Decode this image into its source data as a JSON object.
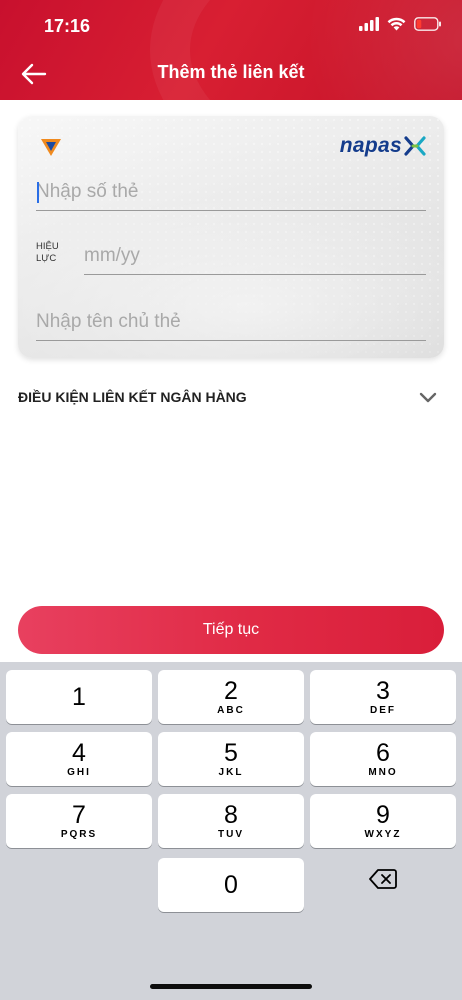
{
  "status_bar": {
    "time": "17:16"
  },
  "header": {
    "title": "Thêm thẻ liên kết"
  },
  "card": {
    "network": "napas",
    "card_number": {
      "value": "",
      "placeholder": "Nhập số thẻ"
    },
    "validity_label": "HIỆU\nLỰC",
    "expiry": {
      "value": "",
      "placeholder": "mm/yy"
    },
    "holder_name": {
      "value": "",
      "placeholder": "Nhập tên chủ thẻ"
    }
  },
  "conditions": {
    "label": "ĐIỀU KIỆN LIÊN KẾT NGÂN HÀNG",
    "icon": "chevron-down-icon"
  },
  "continue_button": {
    "label": "Tiếp tục"
  },
  "keypad": {
    "keys": [
      {
        "digit": "1",
        "letters": ""
      },
      {
        "digit": "2",
        "letters": "ABC"
      },
      {
        "digit": "3",
        "letters": "DEF"
      },
      {
        "digit": "4",
        "letters": "GHI"
      },
      {
        "digit": "5",
        "letters": "JKL"
      },
      {
        "digit": "6",
        "letters": "MNO"
      },
      {
        "digit": "7",
        "letters": "PQRS"
      },
      {
        "digit": "8",
        "letters": "TUV"
      },
      {
        "digit": "9",
        "letters": "WXYZ"
      },
      {
        "digit": "0",
        "letters": ""
      }
    ],
    "backspace_icon": "backspace-icon"
  },
  "colors": {
    "header_red": "#c8102e",
    "button_red": "#e02a45",
    "napas_blue": "#143c8c",
    "keypad_bg": "#d1d3d9"
  }
}
